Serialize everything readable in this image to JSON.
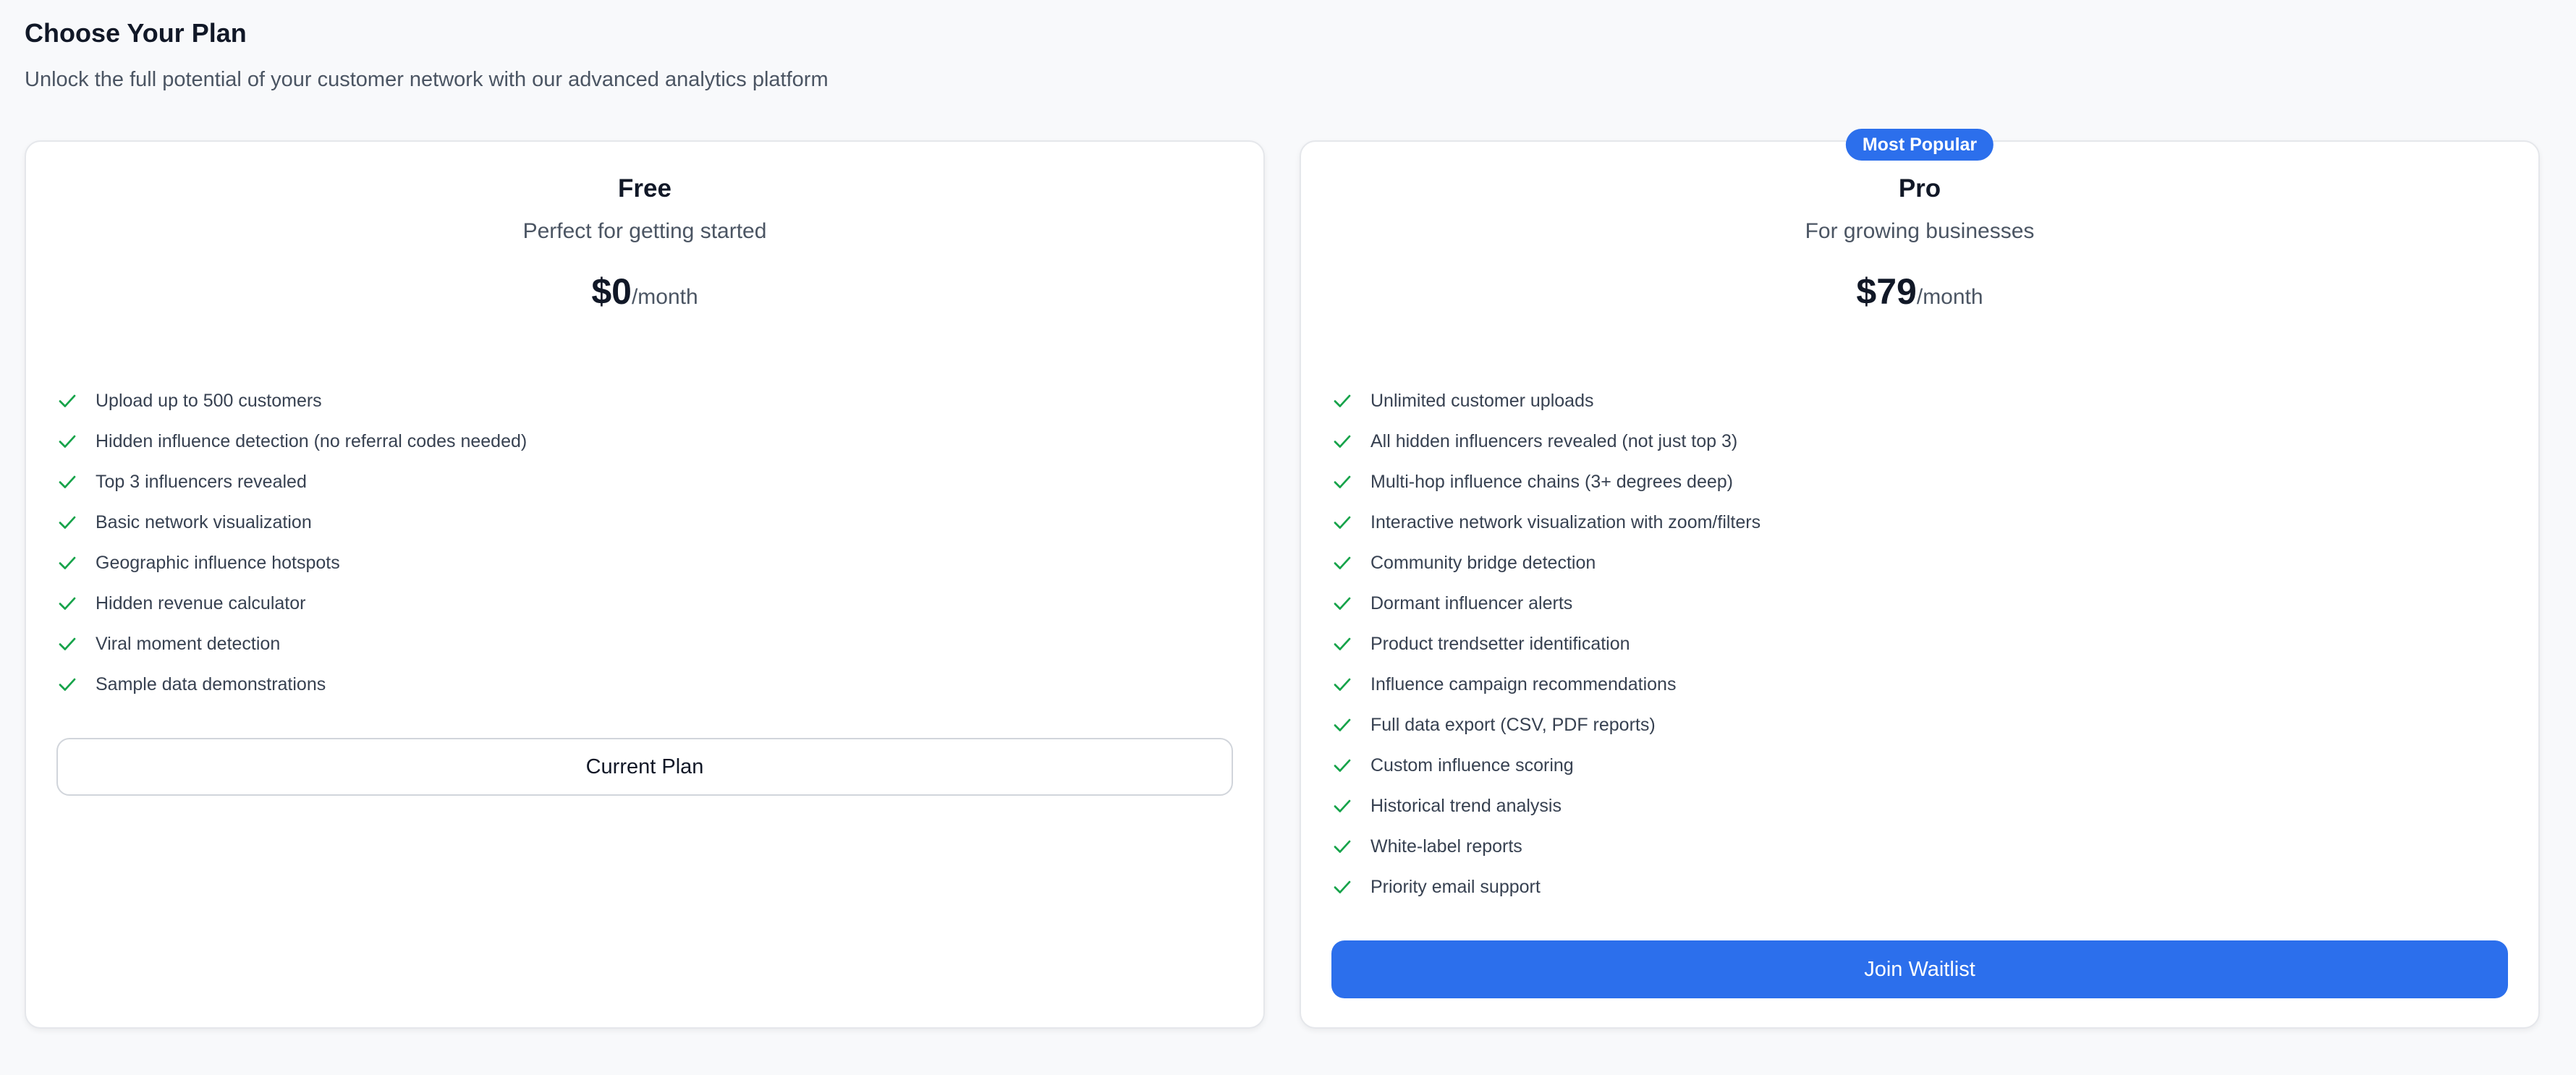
{
  "header": {
    "title": "Choose Your Plan",
    "subtitle": "Unlock the full potential of your customer network with our advanced analytics platform"
  },
  "colors": {
    "accent": "#2c6fec",
    "check": "#16a34a",
    "background": "#f8f9fb"
  },
  "plans": [
    {
      "name": "Free",
      "description": "Perfect for getting started",
      "price": "$0",
      "period": "/month",
      "features": [
        "Upload up to 500 customers",
        "Hidden influence detection (no referral codes needed)",
        "Top 3 influencers revealed",
        "Basic network visualization",
        "Geographic influence hotspots",
        "Hidden revenue calculator",
        "Viral moment detection",
        "Sample data demonstrations"
      ],
      "button_label": "Current Plan"
    },
    {
      "name": "Pro",
      "badge": "Most Popular",
      "description": "For growing businesses",
      "price": "$79",
      "period": "/month",
      "features": [
        "Unlimited customer uploads",
        "All hidden influencers revealed (not just top 3)",
        "Multi-hop influence chains (3+ degrees deep)",
        "Interactive network visualization with zoom/filters",
        "Community bridge detection",
        "Dormant influencer alerts",
        "Product trendsetter identification",
        "Influence campaign recommendations",
        "Full data export (CSV, PDF reports)",
        "Custom influence scoring",
        "Historical trend analysis",
        "White-label reports",
        "Priority email support"
      ],
      "button_label": "Join Waitlist"
    }
  ]
}
